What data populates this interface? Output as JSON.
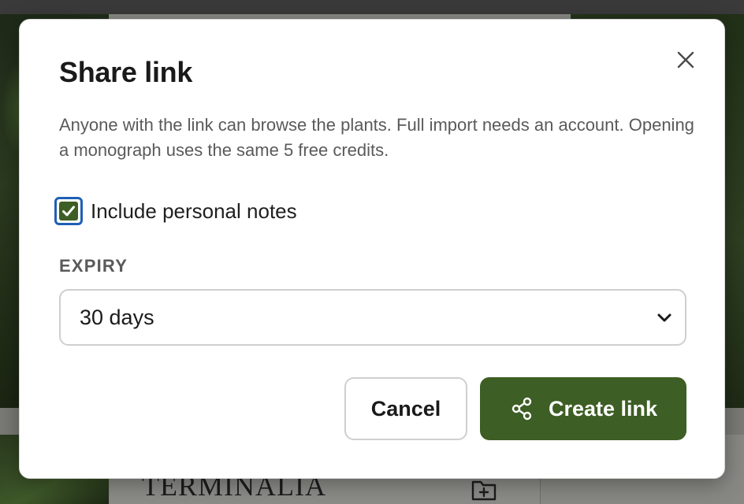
{
  "background": {
    "genus_heading": "TERMINALIA",
    "folder_icon": "folder-plus-icon"
  },
  "dialog": {
    "title": "Share link",
    "close_icon": "close-icon",
    "description": "Anyone with the link can browse the plants. Full import needs an account. Opening a monograph uses the same 5 free credits.",
    "include_notes": {
      "label": "Include personal notes",
      "checked": true
    },
    "expiry": {
      "label": "EXPIRY",
      "selected": "30 days",
      "chevron_icon": "chevron-down-icon"
    },
    "buttons": {
      "cancel": "Cancel",
      "create": "Create link",
      "create_icon": "share-icon"
    }
  },
  "colors": {
    "primary": "#3d5e24",
    "focus_ring": "#1f5fb5",
    "text": "#1a1a1a",
    "muted_text": "#5a5a5a",
    "border": "#cfcfcf"
  }
}
